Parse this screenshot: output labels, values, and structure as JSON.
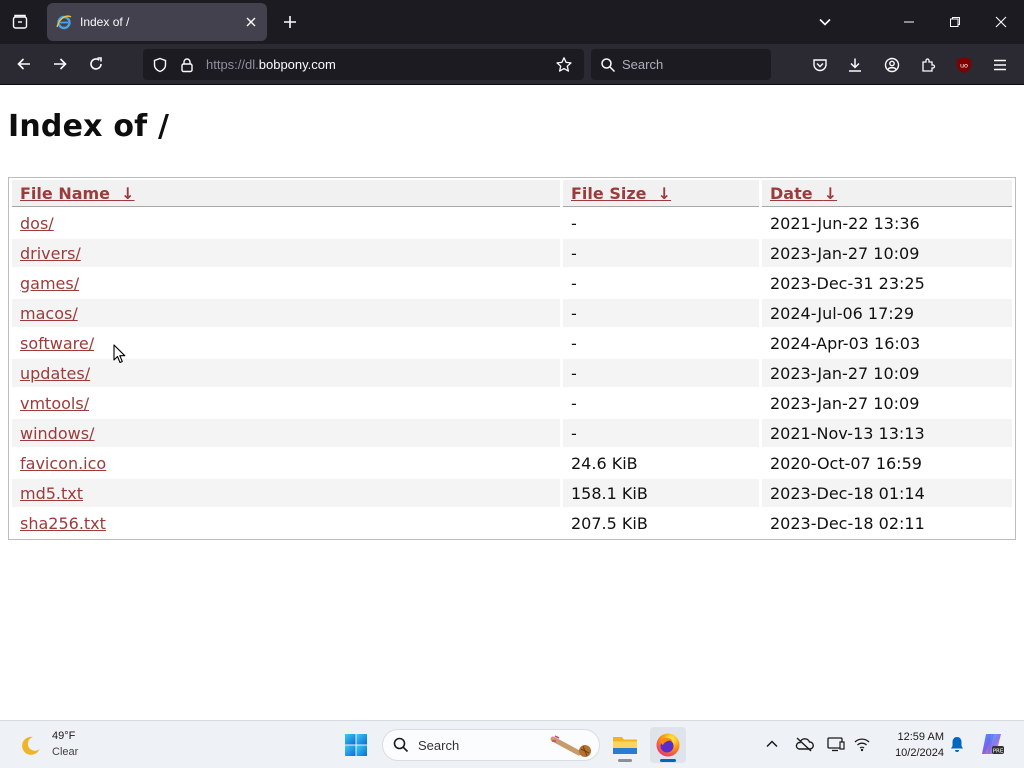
{
  "browser": {
    "tab": {
      "title": "Index of /"
    },
    "url": {
      "scheme": "https://dl.",
      "host": "bobpony.com"
    },
    "search_placeholder": "Search"
  },
  "page": {
    "heading": "Index of /",
    "columns": {
      "name": "File Name",
      "size": "File Size",
      "date": "Date",
      "sort_glyph": "↓"
    },
    "rows": [
      {
        "name": "dos/",
        "size": "-",
        "date": "2021-Jun-22 13:36"
      },
      {
        "name": "drivers/",
        "size": "-",
        "date": "2023-Jan-27 10:09"
      },
      {
        "name": "games/",
        "size": "-",
        "date": "2023-Dec-31 23:25"
      },
      {
        "name": "macos/",
        "size": "-",
        "date": "2024-Jul-06 17:29"
      },
      {
        "name": "software/",
        "size": "-",
        "date": "2024-Apr-03 16:03"
      },
      {
        "name": "updates/",
        "size": "-",
        "date": "2023-Jan-27 10:09"
      },
      {
        "name": "vmtools/",
        "size": "-",
        "date": "2023-Jan-27 10:09"
      },
      {
        "name": "windows/",
        "size": "-",
        "date": "2021-Nov-13 13:13"
      },
      {
        "name": "favicon.ico",
        "size": "24.6 KiB",
        "date": "2020-Oct-07 16:59"
      },
      {
        "name": "md5.txt",
        "size": "158.1 KiB",
        "date": "2023-Dec-18 01:14"
      },
      {
        "name": "sha256.txt",
        "size": "207.5 KiB",
        "date": "2023-Dec-18 02:11"
      }
    ]
  },
  "taskbar": {
    "weather": {
      "temp": "49°F",
      "condition": "Clear"
    },
    "search_label": "Search",
    "clock": {
      "time": "12:59 AM",
      "date": "10/2/2024"
    }
  },
  "colors": {
    "link": "#9b3b3b",
    "chrome_dark": "#1c1b22",
    "toolbar": "#2b2a33",
    "taskbar": "#eef1f6",
    "accent": "#0067c0"
  },
  "icons": [
    "tab-list-icon",
    "ie-favicon-icon",
    "close-icon",
    "plus-icon",
    "chevron-down-icon",
    "minimize-icon",
    "restore-icon",
    "back-icon",
    "forward-icon",
    "reload-icon",
    "shield-icon",
    "lock-icon",
    "star-icon",
    "search-icon",
    "pocket-icon",
    "download-icon",
    "account-icon",
    "extensions-icon",
    "ublock-icon",
    "menu-icon",
    "moon-icon",
    "windows-logo-icon",
    "file-explorer-icon",
    "firefox-icon",
    "chevron-up-icon",
    "onedrive-icon",
    "display-icon",
    "network-icon",
    "notification-bell-icon",
    "copilot-icon"
  ]
}
